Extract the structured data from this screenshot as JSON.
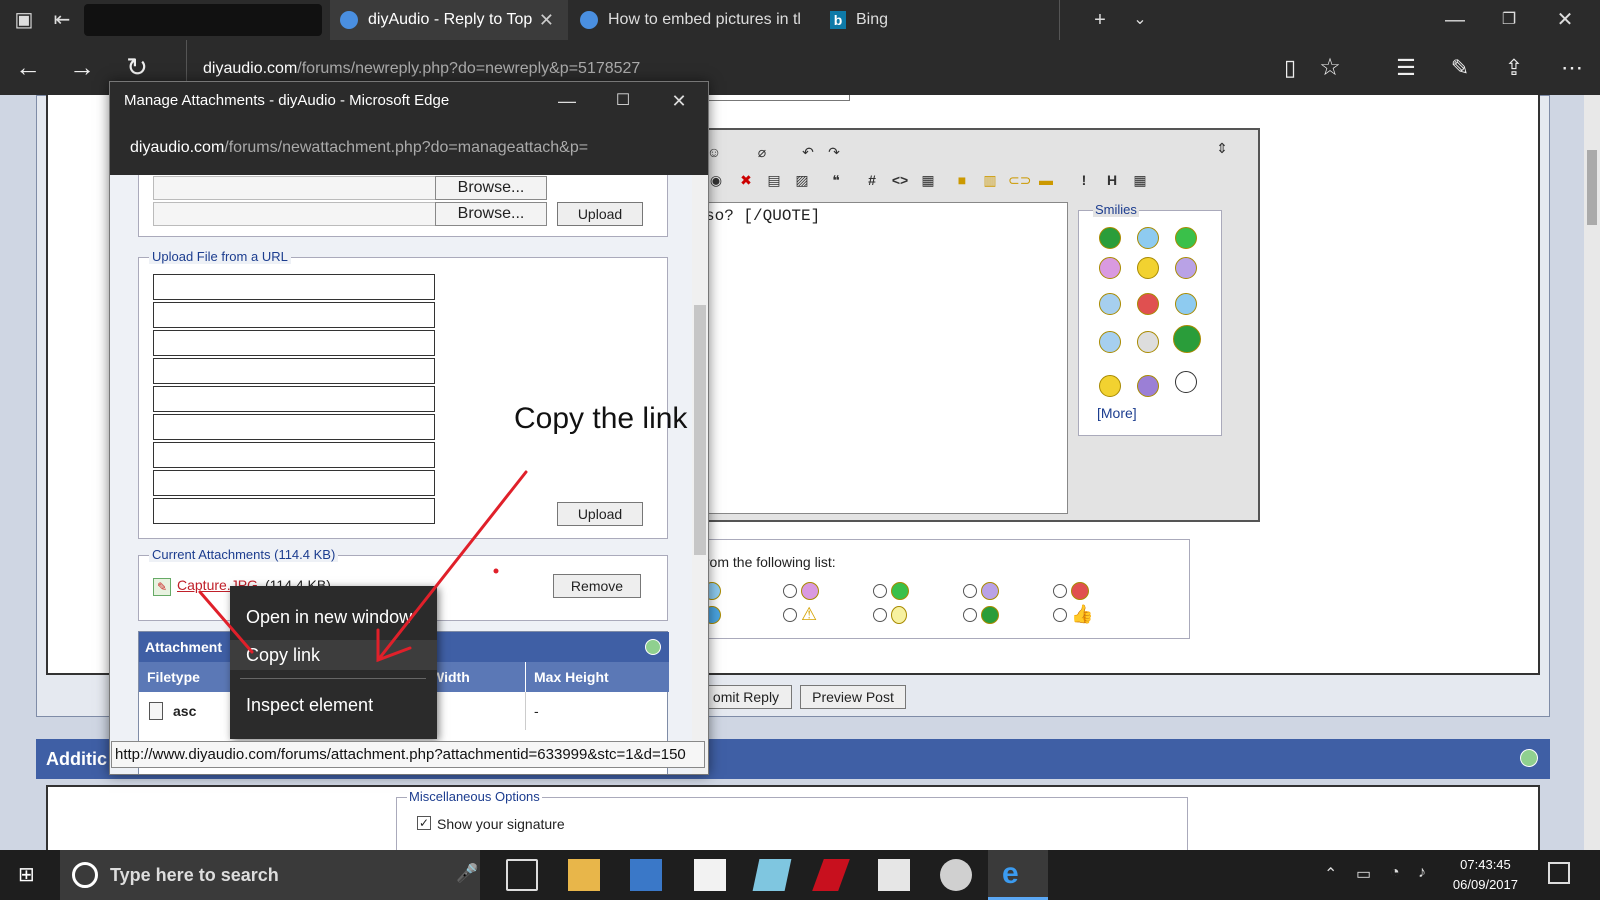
{
  "browser": {
    "tabs": [
      {
        "label": "diyAudio - Reply to Top",
        "active": true
      },
      {
        "label": "How to embed pictures in tl",
        "active": false
      },
      {
        "label": "Bing",
        "active": false
      }
    ],
    "address": {
      "domain": "diyaudio.com",
      "path": "/forums/newreply.php?do=newreply&p=5178527"
    }
  },
  "popup": {
    "title": "Manage Attachments - diyAudio - Microsoft Edge",
    "address": {
      "domain": "diyaudio.com",
      "path": "/forums/newattachment.php?do=manageattach&p="
    },
    "browse_label": "Browse...",
    "upload_label": "Upload",
    "url_section_legend": "Upload File from a URL",
    "attachments_legend": "Current Attachments (114.4 KB)",
    "attachment_file": "Capture.JPG",
    "attachment_size": "(114.4 KB)",
    "remove_label": "Remove",
    "table_title": "Attachment",
    "table_headers": [
      "Filetype",
      "",
      "Width",
      "Max Height"
    ],
    "table_row": {
      "filetype": "asc",
      "max_height": "-"
    }
  },
  "context_menu": {
    "items": [
      "Open in new window",
      "Copy link",
      "Inspect element"
    ]
  },
  "status_url": "http://www.diyaudio.com/forums/attachment.php?attachmentid=633999&stc=1&d=150",
  "annotation_text": "Copy the link",
  "editor": {
    "text": "so? [/QUOTE]",
    "smilies_title": "Smilies",
    "more_link": "[More]",
    "icon_list_text": "from the following list:",
    "submit_label": "omit Reply",
    "preview_label": "Preview Post"
  },
  "page": {
    "additional_header": "Additic",
    "misc_legend": "Miscellaneous Options",
    "show_signature": "Show your signature"
  },
  "taskbar": {
    "search_placeholder": "Type here to search",
    "time": "07:43:45",
    "date": "06/09/2017"
  },
  "colors": {
    "accent": "#1c3d8f",
    "header_bg": "#3f5fa5",
    "annotation": "#e0202a"
  }
}
